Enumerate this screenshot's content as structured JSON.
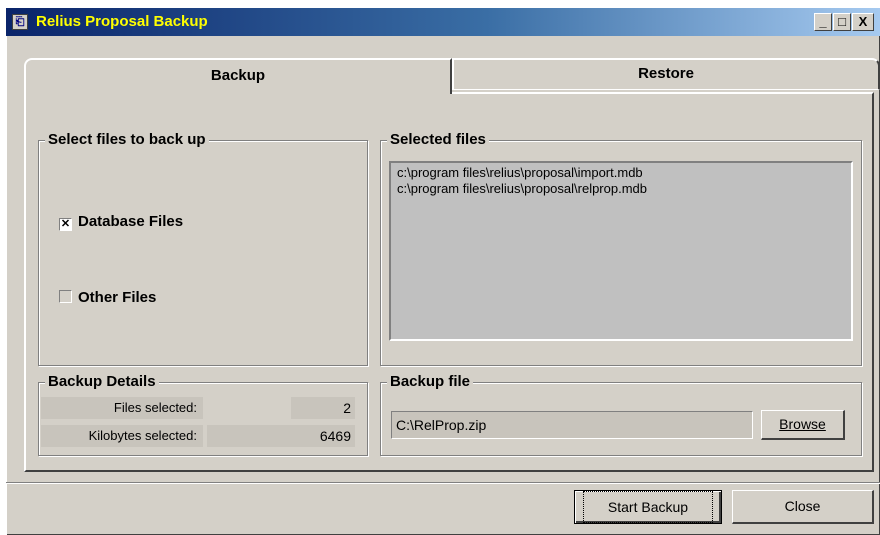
{
  "window": {
    "title": "Relius Proposal Backup"
  },
  "title_buttons": {
    "minimize": "_",
    "maximize": "□",
    "close": "X"
  },
  "tabs": [
    {
      "label": "Backup"
    },
    {
      "label": "Restore"
    }
  ],
  "select_files": {
    "label": "Select files to back up",
    "database_files": {
      "label": "Database Files",
      "checked": true,
      "mark": "✕"
    },
    "other_files": {
      "label": "Other Files",
      "checked": false
    }
  },
  "selected_files": {
    "label": "Selected files",
    "items": [
      "c:\\program files\\relius\\proposal\\import.mdb",
      "c:\\program files\\relius\\proposal\\relprop.mdb"
    ]
  },
  "backup_details": {
    "label": "Backup Details",
    "files_selected_label": "Files selected:",
    "files_selected_value": "2",
    "kilobytes_selected_label": "Kilobytes selected:",
    "kilobytes_selected_value": "6469"
  },
  "backup_file": {
    "label": "Backup file",
    "value": "C:\\RelProp.zip",
    "browse_label": "Browse"
  },
  "actions": {
    "start_backup": "Start Backup",
    "close": "Close"
  },
  "icons": {
    "app": "app-icon",
    "checkbox_mark": "check-x"
  },
  "colors": {
    "title_start": "#0a246a",
    "title_end": "#a6caf0",
    "title_text": "#ffff00",
    "face": "#d4d0c8"
  }
}
